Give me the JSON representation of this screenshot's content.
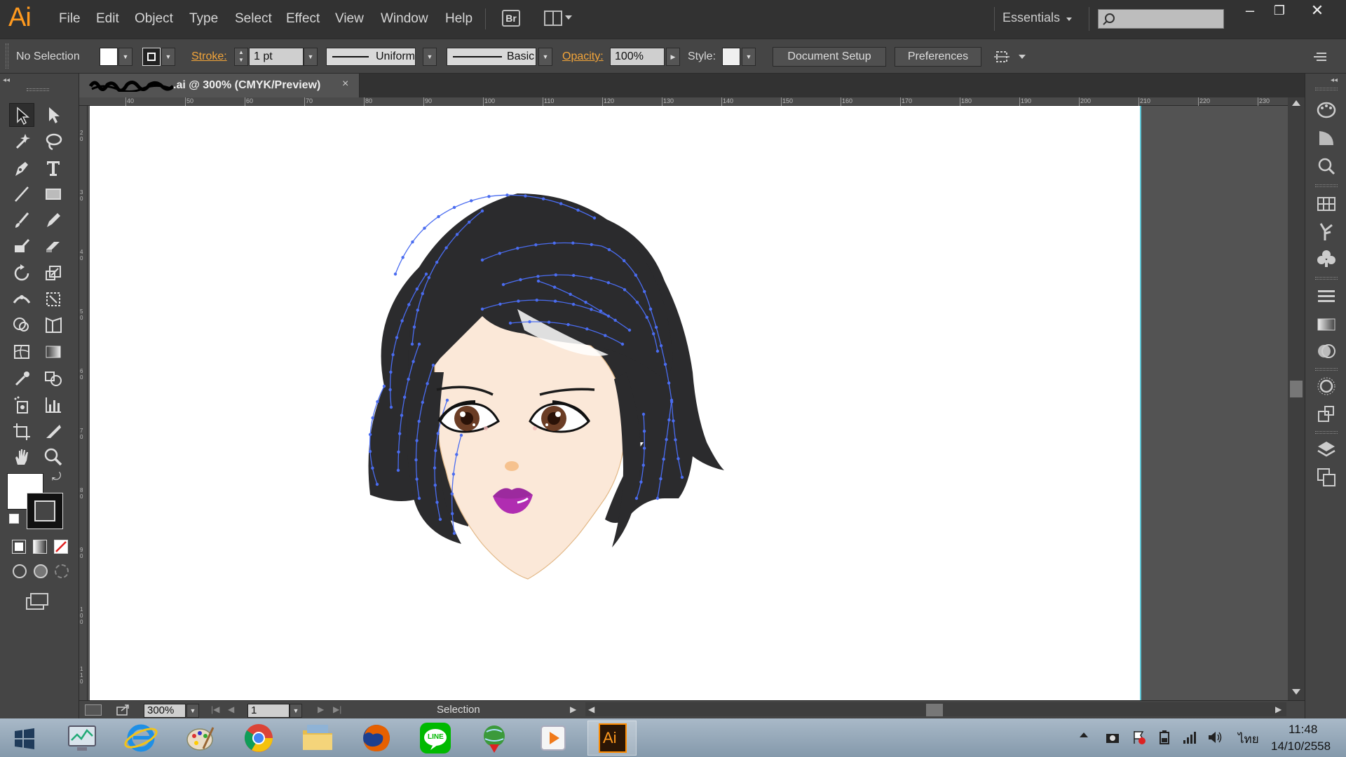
{
  "app": {
    "logo": "Ai",
    "menus": [
      "File",
      "Edit",
      "Object",
      "Type",
      "Select",
      "Effect",
      "View",
      "Window",
      "Help"
    ],
    "bridge_label": "Br",
    "workspace": "Essentials",
    "window_controls": {
      "minimize": "–",
      "restore": "❐",
      "close": "✕"
    }
  },
  "control_bar": {
    "selection": "No Selection",
    "stroke_label": "Stroke:",
    "stroke_weight": "1 pt",
    "stroke_profile": "Uniform",
    "brush": "Basic",
    "opacity_label": "Opacity:",
    "opacity_value": "100%",
    "style_label": "Style:",
    "document_setup": "Document Setup",
    "preferences": "Preferences"
  },
  "document": {
    "tab_title": ".ai @ 300% (CMYK/Preview)",
    "close": "×"
  },
  "ruler_h_labels": [
    "40",
    "50",
    "60",
    "70",
    "80",
    "90",
    "100",
    "110",
    "120",
    "130",
    "140",
    "150",
    "160",
    "170",
    "180",
    "190",
    "200",
    "210",
    "220",
    "230"
  ],
  "ruler_v_labels": [
    "2\n0",
    "3\n0",
    "4\n0",
    "5\n0",
    "6\n0",
    "7\n0",
    "8\n0",
    "9\n0",
    "1\n0\n0",
    "1\n1\n0"
  ],
  "status": {
    "zoom": "300%",
    "artboard": "1",
    "tool_name": "Selection"
  },
  "taskbar": {
    "time": "11:48",
    "date": "14/10/2558",
    "language": "ไทย",
    "line_label": "LINE",
    "ai_label": "Ai"
  },
  "colors": {
    "accent": "#ff9a1f",
    "hair": "#2b2b2d",
    "skin": "#fbe8d8",
    "lips": "#b02db1",
    "iris": "#6b3d25",
    "anchor": "#4a6cf0"
  }
}
